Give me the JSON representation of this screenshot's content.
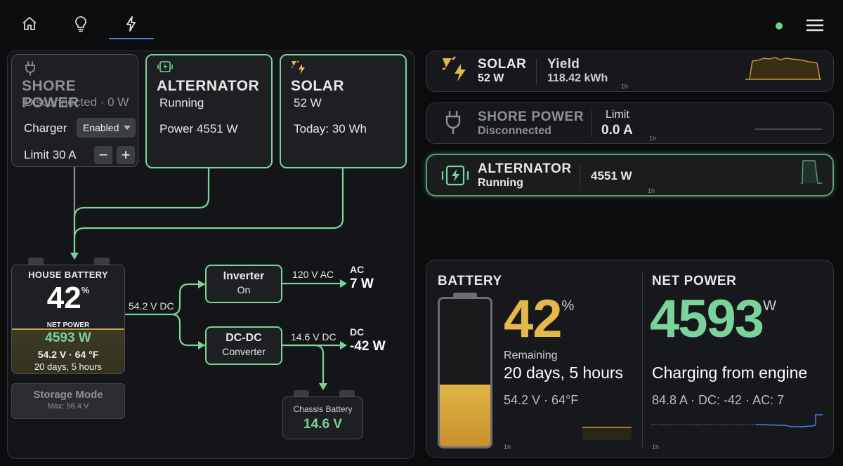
{
  "nav": {
    "items": [
      {
        "name": "home",
        "icon": "home-icon"
      },
      {
        "name": "lights",
        "icon": "lightbulb-icon"
      },
      {
        "name": "power",
        "icon": "lightning-icon",
        "active": true
      }
    ]
  },
  "colors": {
    "accent_green": "#7ad39a",
    "accent_yellow": "#e4b84a",
    "active_tab": "#4a86d8"
  },
  "flow": {
    "shore": {
      "title": "SHORE POWER",
      "status": "Disconnected · 0 W",
      "charger_label": "Charger",
      "charger_value": "Enabled",
      "limit_label": "Limit 30 A",
      "minus": "−",
      "plus": "+"
    },
    "alternator": {
      "title": "ALTERNATOR",
      "status": "Running",
      "power": "Power 4551 W"
    },
    "solar": {
      "title": "SOLAR",
      "power": "52 W",
      "today": "Today: 30 Wh"
    },
    "house_battery": {
      "title": "HOUSE BATTERY",
      "soc": "42",
      "soc_unit": "%",
      "net_label": "NET POWER",
      "net_value": "4593 W",
      "voltage_temp": "54.2 V · 64 °F",
      "time_remaining": "20 days, 5 hours",
      "soc_fraction": 0.42
    },
    "bus_label": "54.2 V DC",
    "inverter": {
      "title": "Inverter",
      "status": "On",
      "line_label": "120 V AC",
      "out_label": "AC",
      "out_value": "7 W"
    },
    "dcdc": {
      "title": "DC-DC",
      "subtitle": "Converter",
      "line_label": "14.6 V DC",
      "out_label": "DC",
      "out_value": "-42 W"
    },
    "storage": {
      "title": "Storage Mode",
      "sub": "Max: 56.4 V"
    },
    "chassis": {
      "title": "Chassis Battery",
      "value": "14.6 V"
    }
  },
  "cards": {
    "solar": {
      "title": "SOLAR",
      "power": "52 W",
      "yield_label": "Yield",
      "yield_value": "118.42 kWh",
      "spark_label": "1h"
    },
    "shore": {
      "title": "SHORE POWER",
      "status": "Disconnected",
      "limit_label": "Limit",
      "limit_value": "0.0 A",
      "spark_label": "1h"
    },
    "alternator": {
      "title": "ALTERNATOR",
      "status": "Running",
      "power": "4551 W",
      "spark_label": "1h"
    }
  },
  "battery": {
    "title": "BATTERY",
    "soc": "42",
    "soc_unit": "%",
    "remaining_label": "Remaining",
    "remaining_value": "20 days, 5 hours",
    "voltage_temp": "54.2 V · 64°F",
    "spark_label": "1h",
    "fill_fraction": 0.42
  },
  "net_power": {
    "title": "NET POWER",
    "value": "4593",
    "unit": "W",
    "status": "Charging from engine",
    "details": "84.8 A · DC: -42 · AC: 7",
    "spark_label": "1h"
  }
}
